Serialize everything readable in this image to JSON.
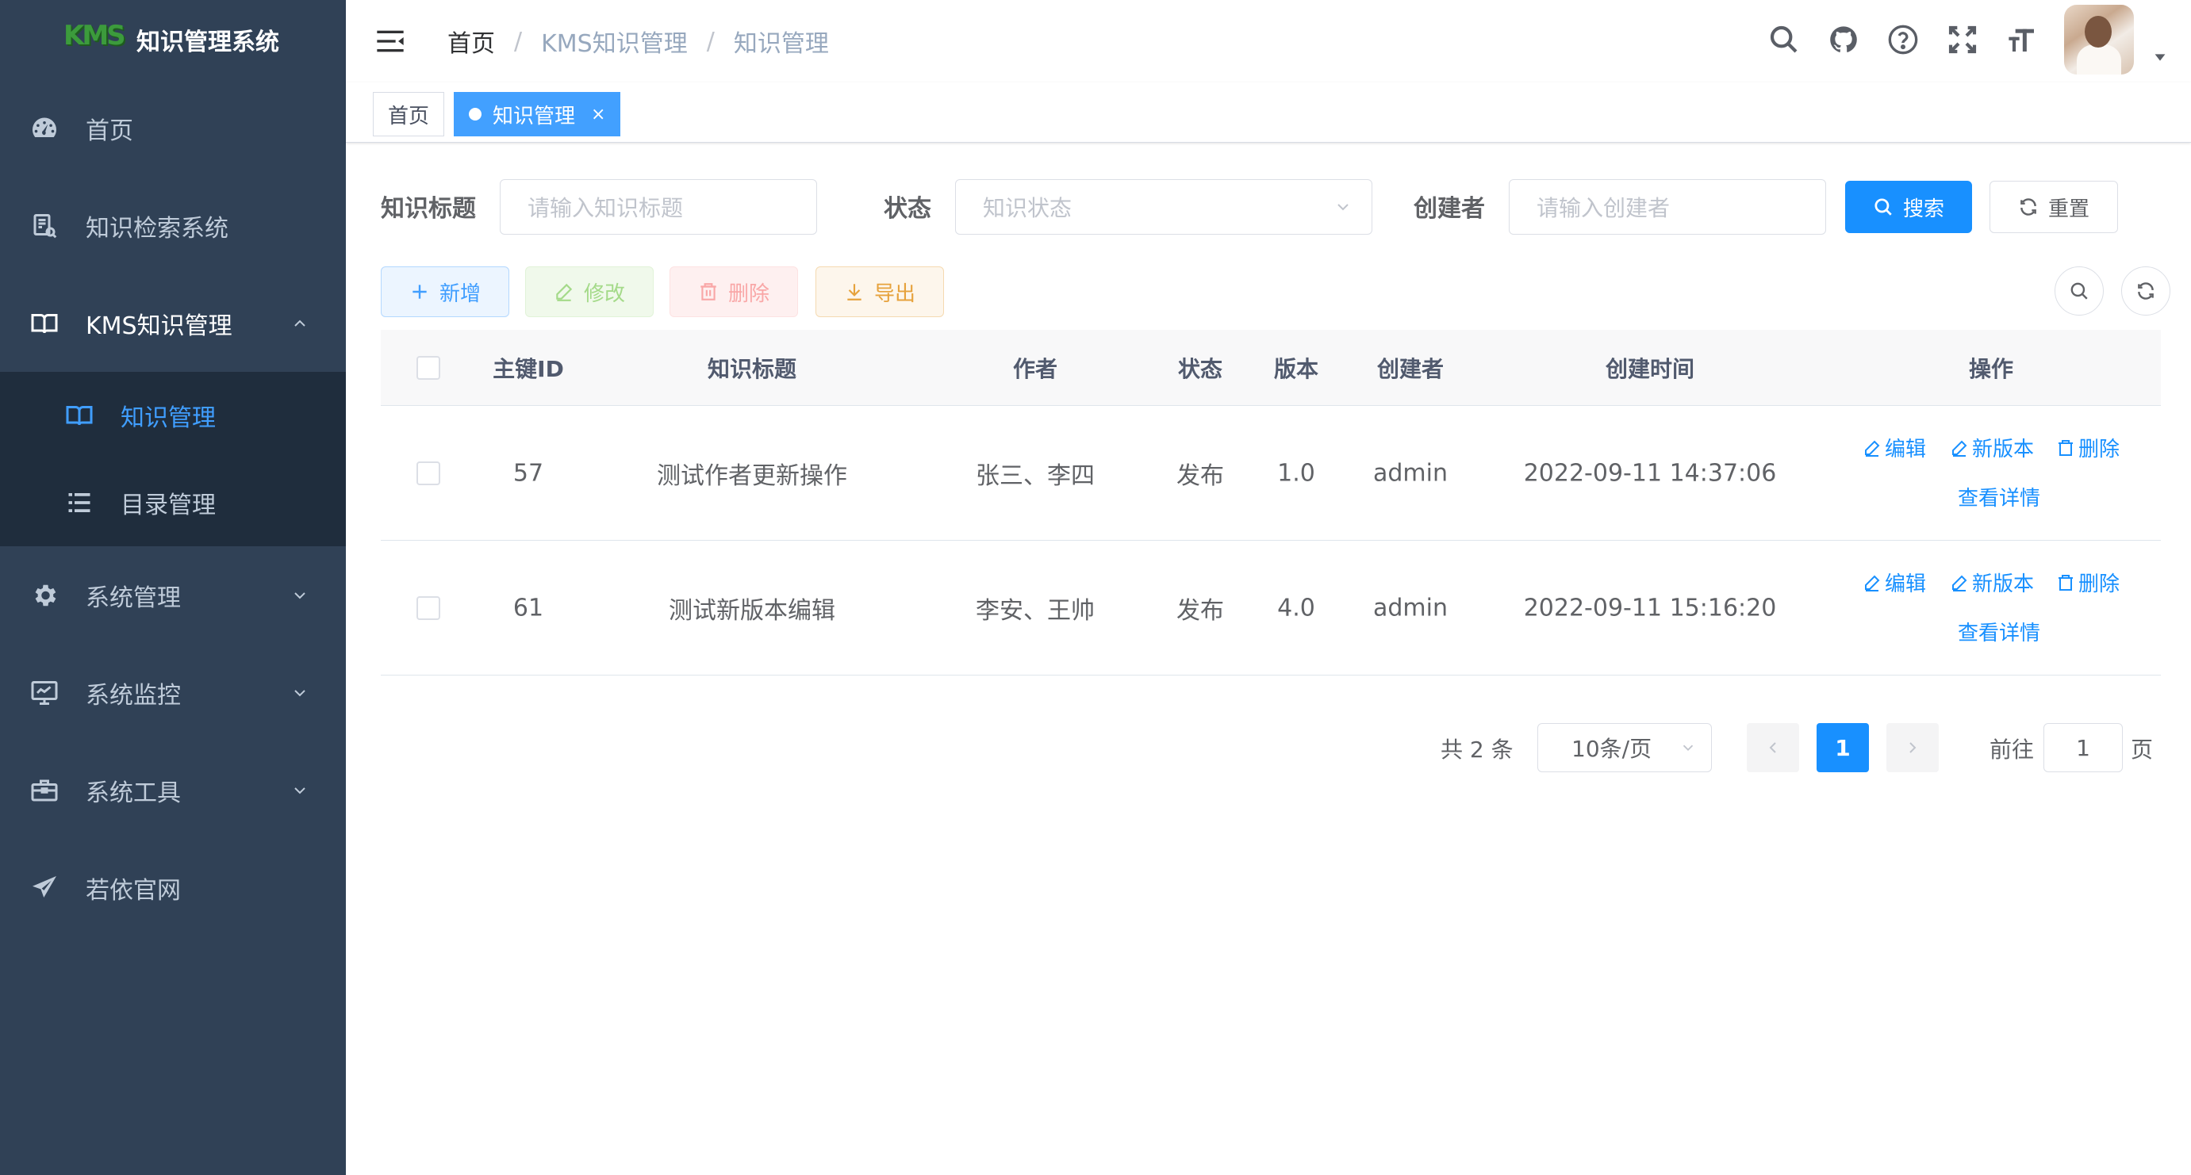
{
  "app": {
    "title": "知识管理系统",
    "logo_text": "KMS"
  },
  "sidebar": {
    "items": [
      {
        "label": "首页",
        "icon": "dashboard-icon"
      },
      {
        "label": "知识检索系统",
        "icon": "document-search-icon"
      },
      {
        "label": "KMS知识管理",
        "icon": "book-icon",
        "expanded": true,
        "children": [
          {
            "label": "知识管理",
            "icon": "book-icon",
            "active": true
          },
          {
            "label": "目录管理",
            "icon": "list-icon"
          }
        ]
      },
      {
        "label": "系统管理",
        "icon": "gear-icon"
      },
      {
        "label": "系统监控",
        "icon": "monitor-icon"
      },
      {
        "label": "系统工具",
        "icon": "toolbox-icon"
      },
      {
        "label": "若依官网",
        "icon": "paper-plane-icon"
      }
    ]
  },
  "breadcrumb": [
    "首页",
    "KMS知识管理",
    "知识管理"
  ],
  "tags": {
    "home": "首页",
    "active": "知识管理",
    "close": "×"
  },
  "search": {
    "title_label": "知识标题",
    "title_placeholder": "请输入知识标题",
    "status_label": "状态",
    "status_placeholder": "知识状态",
    "creator_label": "创建者",
    "creator_placeholder": "请输入创建者",
    "search_button": "搜索",
    "reset_button": "重置"
  },
  "toolbar": {
    "add": "新增",
    "edit": "修改",
    "delete": "删除",
    "export": "导出"
  },
  "table": {
    "columns": [
      "主键ID",
      "知识标题",
      "作者",
      "状态",
      "版本",
      "创建者",
      "创建时间",
      "操作"
    ],
    "rows": [
      {
        "id": "57",
        "title": "测试作者更新操作",
        "author": "张三、李四",
        "status": "发布",
        "version": "1.0",
        "creator": "admin",
        "created": "2022-09-11 14:37:06"
      },
      {
        "id": "61",
        "title": "测试新版本编辑",
        "author": "李安、王帅",
        "status": "发布",
        "version": "4.0",
        "creator": "admin",
        "created": "2022-09-11 15:16:20"
      }
    ],
    "actions": {
      "edit": "编辑",
      "new_version": "新版本",
      "delete": "删除",
      "detail": "查看详情"
    }
  },
  "pagination": {
    "total": "共 2 条",
    "page_size": "10条/页",
    "current": "1",
    "goto_label": "前往",
    "goto_value": "1",
    "page_suffix": "页"
  },
  "colors": {
    "sidebar_bg": "#304156",
    "submenu_bg": "#1f2d3d",
    "accent": "#1890ff",
    "active_menu": "#409eff"
  }
}
